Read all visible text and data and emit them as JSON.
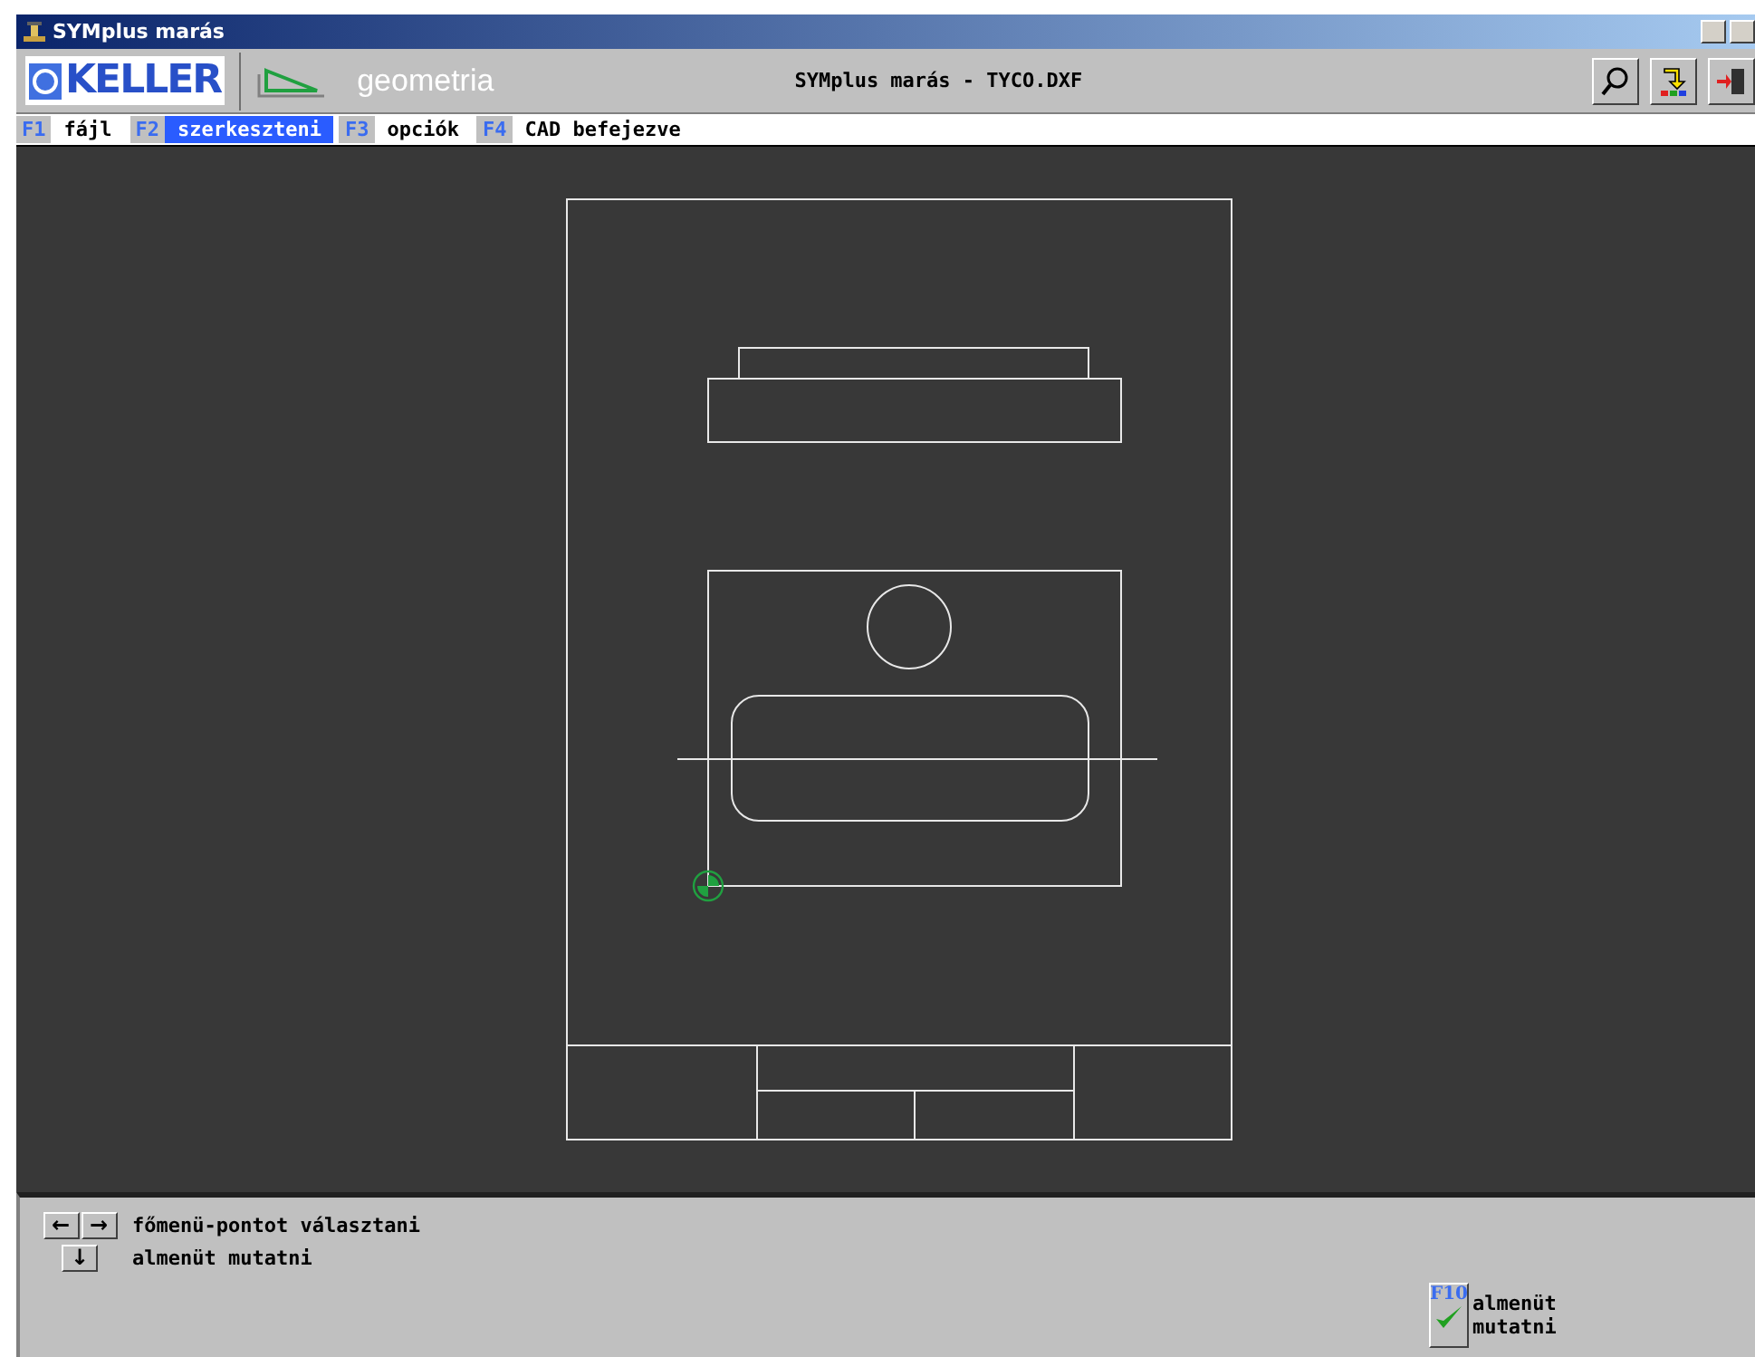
{
  "window": {
    "title": "SYMplus marás"
  },
  "toolbar": {
    "brand": "KELLER",
    "module": "geometria",
    "document_title": "SYMplus marás - TYCO.DXF"
  },
  "menu": [
    {
      "key": "F1",
      "label": "fájl",
      "selected": false
    },
    {
      "key": "F2",
      "label": "szerkeszteni",
      "selected": true
    },
    {
      "key": "F3",
      "label": "opciók",
      "selected": false
    },
    {
      "key": "F4",
      "label": "CAD befejezve",
      "selected": false
    }
  ],
  "hints": [
    {
      "keys": [
        "←",
        "→"
      ],
      "text": "főmenü-pontot választani"
    },
    {
      "keys": [
        "↓"
      ],
      "text": "almenüt mutatni"
    }
  ],
  "f10_button": {
    "key": "F10",
    "lines": [
      "almenüt",
      "mutatni"
    ]
  }
}
